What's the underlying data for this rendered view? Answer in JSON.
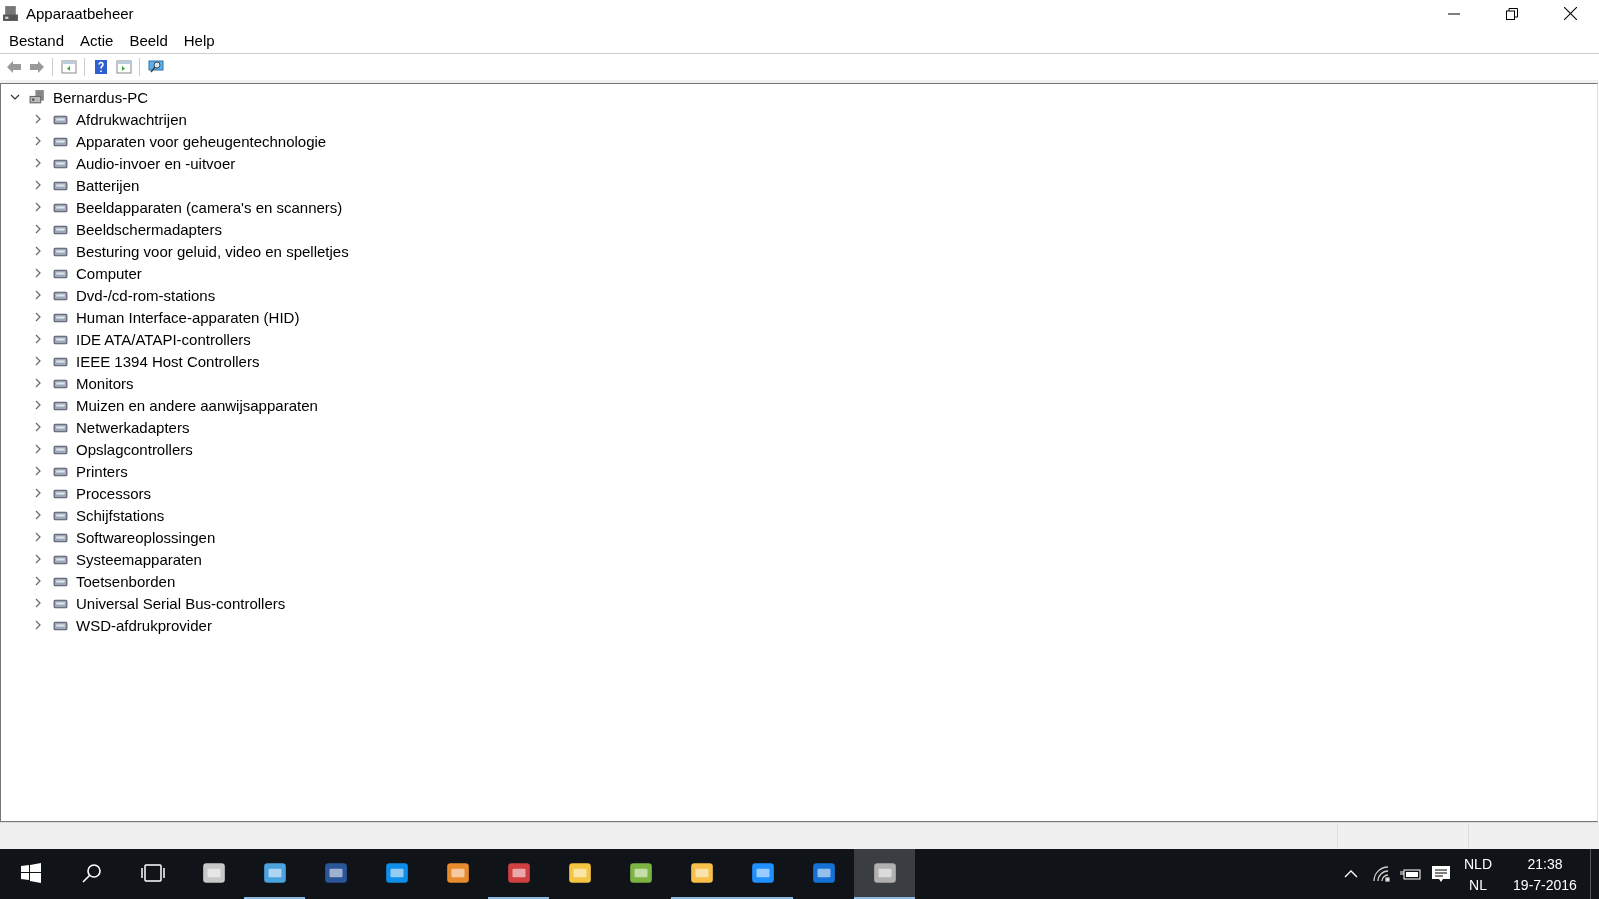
{
  "window": {
    "title": "Apparaatbeheer"
  },
  "menu": [
    "Bestand",
    "Actie",
    "Beeld",
    "Help"
  ],
  "tree": {
    "label": "Bernardus-PC",
    "expanded": true,
    "children": [
      {
        "label": "Afdrukwachtrijen",
        "expanded": false
      },
      {
        "label": "Apparaten voor geheugentechnologie",
        "expanded": false
      },
      {
        "label": "Audio-invoer en -uitvoer",
        "expanded": false
      },
      {
        "label": "Batterijen",
        "expanded": false
      },
      {
        "label": "Beeldapparaten (camera's en scanners)",
        "expanded": false
      },
      {
        "label": "Beeldschermadapters",
        "expanded": false
      },
      {
        "label": "Besturing voor geluid, video en spelletjes",
        "expanded": false
      },
      {
        "label": "Computer",
        "expanded": false
      },
      {
        "label": "Dvd-/cd-rom-stations",
        "expanded": false
      },
      {
        "label": "Human Interface-apparaten (HID)",
        "expanded": false
      },
      {
        "label": "IDE ATA/ATAPI-controllers",
        "expanded": false
      },
      {
        "label": "IEEE 1394 Host Controllers",
        "expanded": false
      },
      {
        "label": "Monitors",
        "expanded": false
      },
      {
        "label": "Muizen en andere aanwijsapparaten",
        "expanded": false
      },
      {
        "label": "Netwerkadapters",
        "expanded": false
      },
      {
        "label": "Opslagcontrollers",
        "expanded": false
      },
      {
        "label": "Printers",
        "expanded": false
      },
      {
        "label": "Processors",
        "expanded": false
      },
      {
        "label": "Schijfstations",
        "expanded": false
      },
      {
        "label": "Softwareoplossingen",
        "expanded": false
      },
      {
        "label": "Systeemapparaten",
        "expanded": false
      },
      {
        "label": "Toetsenborden",
        "expanded": false
      },
      {
        "label": "Universal Serial Bus-controllers",
        "expanded": false
      },
      {
        "label": "WSD-afdrukprovider",
        "expanded": false
      }
    ]
  },
  "taskbar": {
    "apps": [
      {
        "running": false,
        "selected": false,
        "color": "#c8c8c8"
      },
      {
        "running": true,
        "selected": false,
        "color": "#4aa3df"
      },
      {
        "running": false,
        "selected": false,
        "color": "#2b579a"
      },
      {
        "running": false,
        "selected": false,
        "color": "#0e8ee9"
      },
      {
        "running": false,
        "selected": false,
        "color": "#e88a2e"
      },
      {
        "running": true,
        "selected": false,
        "color": "#d04040"
      },
      {
        "running": false,
        "selected": false,
        "color": "#f3c541"
      },
      {
        "running": false,
        "selected": false,
        "color": "#7cb342"
      },
      {
        "running": true,
        "selected": false,
        "color": "#f6c04a"
      },
      {
        "running": true,
        "selected": false,
        "color": "#1e90ff"
      },
      {
        "running": false,
        "selected": false,
        "color": "#1572d4"
      },
      {
        "running": true,
        "selected": true,
        "color": "#b0b0b0"
      }
    ],
    "language": "NLD",
    "keyboard": "NL",
    "time": "21:38",
    "date": "19-7-2016"
  }
}
